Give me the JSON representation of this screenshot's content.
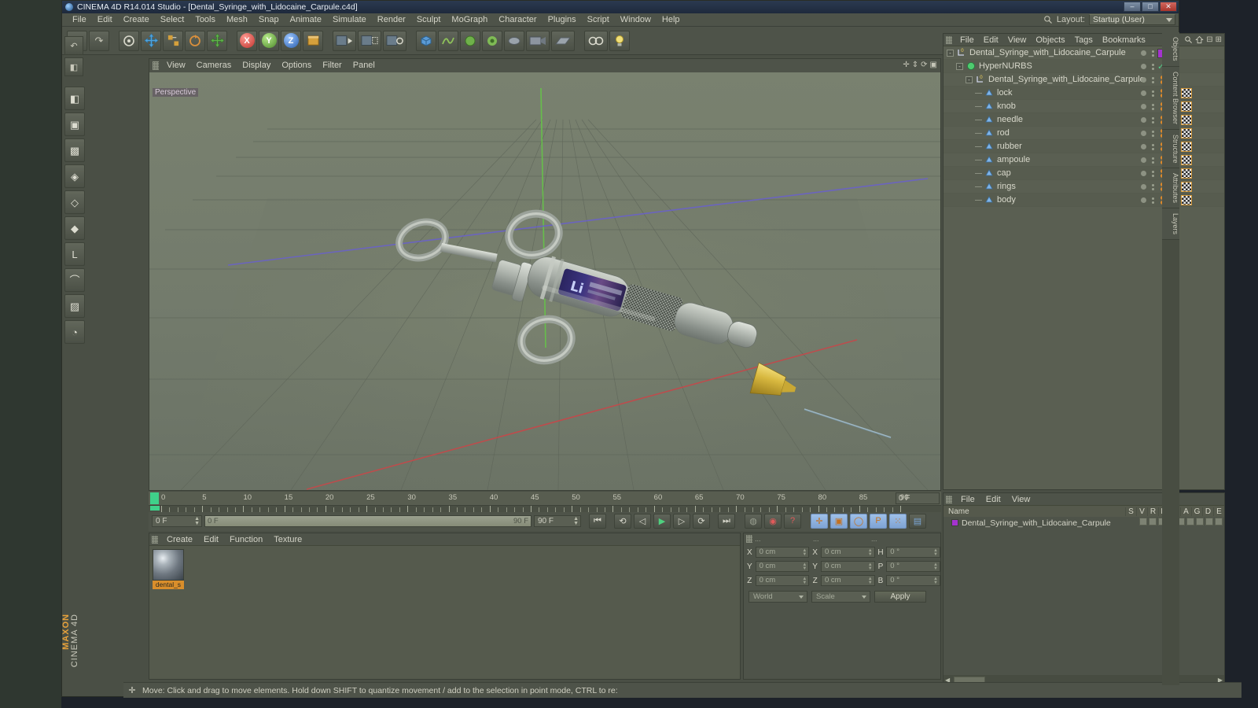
{
  "window": {
    "title": "CINEMA 4D R14.014 Studio - [Dental_Syringe_with_Lidocaine_Carpule.c4d]",
    "min_label": "–",
    "max_label": "□",
    "close_label": "✕"
  },
  "menubar": {
    "items": [
      "File",
      "Edit",
      "Create",
      "Select",
      "Tools",
      "Mesh",
      "Snap",
      "Animate",
      "Simulate",
      "Render",
      "Sculpt",
      "MoGraph",
      "Character",
      "Plugins",
      "Script",
      "Window",
      "Help"
    ],
    "layout_label": "Layout:",
    "layout_value": "Startup (User)"
  },
  "viewport": {
    "menu": [
      "View",
      "Cameras",
      "Display",
      "Options",
      "Filter",
      "Panel"
    ],
    "label": "Perspective",
    "axis_labels": {
      "x": "X",
      "y": "Y",
      "z": "Z"
    }
  },
  "timeline": {
    "ticks": [
      "0",
      "5",
      "10",
      "15",
      "20",
      "25",
      "30",
      "35",
      "40",
      "45",
      "50",
      "55",
      "60",
      "65",
      "70",
      "75",
      "80",
      "85",
      "90"
    ],
    "current_frame_field": "0 F",
    "start_field": "0 F",
    "slider_left": "0 F",
    "slider_right": "90 F",
    "end_field": "90 F",
    "transport": [
      {
        "name": "go-to-start",
        "glyph": "⏮"
      },
      {
        "name": "play-backwards-frame",
        "glyph": "⟲"
      },
      {
        "name": "step-back",
        "glyph": "◁|"
      },
      {
        "name": "play",
        "glyph": "▶"
      },
      {
        "name": "step-forward",
        "glyph": "|▷"
      },
      {
        "name": "loop",
        "glyph": "⟳"
      },
      {
        "name": "go-to-end",
        "glyph": "⏭"
      }
    ],
    "record_buttons": [
      {
        "name": "record-active-objects",
        "glyph": "◉"
      },
      {
        "name": "autokeying",
        "glyph": "?"
      }
    ],
    "key_buttons": [
      {
        "name": "position-key",
        "glyph": "✛"
      },
      {
        "name": "scale-key",
        "glyph": "▣"
      },
      {
        "name": "rotation-key",
        "glyph": "◯"
      },
      {
        "name": "param-key",
        "glyph": "P"
      },
      {
        "name": "point-level-anim",
        "glyph": "⋯"
      },
      {
        "name": "keyframe-select",
        "glyph": "▤"
      }
    ]
  },
  "materials": {
    "menu": [
      "Create",
      "Edit",
      "Function",
      "Texture"
    ],
    "items": [
      {
        "name": "dental_s"
      }
    ]
  },
  "coordinates": {
    "headers": [
      "...",
      "...",
      "..."
    ],
    "rows": [
      {
        "l1": "X",
        "v1": "0 cm",
        "l2": "X",
        "v2": "0 cm",
        "l3": "H",
        "v3": "0 °"
      },
      {
        "l1": "Y",
        "v1": "0 cm",
        "l2": "Y",
        "v2": "0 cm",
        "l3": "P",
        "v3": "0 °"
      },
      {
        "l1": "Z",
        "v1": "0 cm",
        "l2": "Z",
        "v2": "0 cm",
        "l3": "B",
        "v3": "0 °"
      }
    ],
    "system_select": "World",
    "mode_select": "Scale",
    "apply_label": "Apply"
  },
  "object_manager": {
    "menu": [
      "File",
      "Edit",
      "View",
      "Objects",
      "Tags",
      "Bookmarks"
    ],
    "rows": [
      {
        "label": "Dental_Syringe_with_Lidocaine_Carpule",
        "depth": 0,
        "icon": "null-object-icon",
        "expander": "-",
        "swatch": "#a533cf",
        "has_check": false,
        "has_tags": false,
        "has_orange": false
      },
      {
        "label": "HyperNURBS",
        "depth": 1,
        "icon": "hypernurbs-icon",
        "expander": "-",
        "swatch": "",
        "has_check": true,
        "has_tags": false,
        "has_orange": false
      },
      {
        "label": "Dental_Syringe_with_Lidocaine_Carpule",
        "depth": 2,
        "icon": "null-object-icon",
        "expander": "-",
        "swatch": "",
        "has_check": false,
        "has_tags": false,
        "has_orange": true
      },
      {
        "label": "lock",
        "depth": 3,
        "icon": "polygon-object-icon",
        "expander": "",
        "swatch": "",
        "has_check": false,
        "has_tags": true,
        "has_orange": true
      },
      {
        "label": "knob",
        "depth": 3,
        "icon": "polygon-object-icon",
        "expander": "",
        "swatch": "",
        "has_check": false,
        "has_tags": true,
        "has_orange": true
      },
      {
        "label": "needle",
        "depth": 3,
        "icon": "polygon-object-icon",
        "expander": "",
        "swatch": "",
        "has_check": false,
        "has_tags": true,
        "has_orange": true
      },
      {
        "label": "rod",
        "depth": 3,
        "icon": "polygon-object-icon",
        "expander": "",
        "swatch": "",
        "has_check": false,
        "has_tags": true,
        "has_orange": true
      },
      {
        "label": "rubber",
        "depth": 3,
        "icon": "polygon-object-icon",
        "expander": "",
        "swatch": "",
        "has_check": false,
        "has_tags": true,
        "has_orange": true
      },
      {
        "label": "ampoule",
        "depth": 3,
        "icon": "polygon-object-icon",
        "expander": "",
        "swatch": "",
        "has_check": false,
        "has_tags": true,
        "has_orange": true
      },
      {
        "label": "cap",
        "depth": 3,
        "icon": "polygon-object-icon",
        "expander": "",
        "swatch": "",
        "has_check": false,
        "has_tags": true,
        "has_orange": true
      },
      {
        "label": "rings",
        "depth": 3,
        "icon": "polygon-object-icon",
        "expander": "",
        "swatch": "",
        "has_check": false,
        "has_tags": true,
        "has_orange": true
      },
      {
        "label": "body",
        "depth": 3,
        "icon": "polygon-object-icon",
        "expander": "",
        "swatch": "",
        "has_check": false,
        "has_tags": true,
        "has_orange": true
      }
    ]
  },
  "attributes": {
    "menu": [
      "File",
      "Edit",
      "View"
    ],
    "columns": [
      "Name",
      "S",
      "V",
      "R",
      "M",
      "L",
      "A",
      "G",
      "D",
      "E"
    ],
    "rows": [
      {
        "label": "Dental_Syringe_with_Lidocaine_Carpule",
        "swatch": "#a533cf"
      }
    ]
  },
  "right_tabs": [
    "Objects",
    "Content Browser",
    "Structure",
    "Attributes",
    "Layers"
  ],
  "statusbar": {
    "text": "Move: Click and drag to move elements. Hold down SHIFT to quantize movement / add to the selection in point mode, CTRL to re:"
  },
  "brand": {
    "line1": "MAXON",
    "line2": "CINEMA 4D"
  },
  "toolbar": {
    "groups": [
      [
        {
          "name": "undo-button",
          "glyph": "↶"
        },
        {
          "name": "redo-button",
          "glyph": "↷"
        }
      ],
      [
        {
          "name": "live-selection-button",
          "glyph": "◍"
        },
        {
          "name": "move-button",
          "glyph": "✛"
        },
        {
          "name": "scale-button",
          "glyph": "▣"
        },
        {
          "name": "rotate-button",
          "glyph": "⟳"
        },
        {
          "name": "move-alt-button",
          "glyph": "✛"
        }
      ],
      [
        {
          "name": "lock-x-axis-button",
          "glyph": "X"
        },
        {
          "name": "lock-y-axis-button",
          "glyph": "Y"
        },
        {
          "name": "lock-z-axis-button",
          "glyph": "Z"
        },
        {
          "name": "world-coordinate-button",
          "glyph": "▦"
        }
      ],
      [
        {
          "name": "render-view-button",
          "glyph": "▶▦"
        },
        {
          "name": "render-region-button",
          "glyph": "▦▶"
        },
        {
          "name": "render-settings-button",
          "glyph": "▦⚙"
        }
      ],
      [
        {
          "name": "cube-primitive-button",
          "glyph": "◼"
        },
        {
          "name": "spline-button",
          "glyph": "∿"
        },
        {
          "name": "generator-button",
          "glyph": "◆"
        },
        {
          "name": "deformer-button",
          "glyph": "✺"
        },
        {
          "name": "scene-object-button",
          "glyph": "⬬"
        },
        {
          "name": "camera-button",
          "glyph": "▤"
        },
        {
          "name": "floor-button",
          "glyph": "▱"
        }
      ],
      [
        {
          "name": "mograph-button",
          "glyph": "∞"
        },
        {
          "name": "light-button",
          "glyph": "💡"
        }
      ]
    ]
  },
  "left_toolbar": [
    {
      "name": "make-editable-button",
      "glyph": "◧",
      "selected": false
    },
    {
      "name": "model-mode-button",
      "glyph": "▣",
      "selected": false
    },
    {
      "name": "texture-mode-button",
      "glyph": "▩",
      "selected": false
    },
    {
      "name": "points-mode-button",
      "glyph": "◈",
      "selected": false
    },
    {
      "name": "edges-mode-button",
      "glyph": "◇",
      "selected": false
    },
    {
      "name": "polygons-mode-button",
      "glyph": "◆",
      "selected": false
    },
    {
      "name": "axis-modify-button",
      "glyph": "L",
      "selected": false
    },
    {
      "name": "enable-snapping-button",
      "glyph": "⌒",
      "selected": false
    },
    {
      "name": "workplane-button",
      "glyph": "▨",
      "selected": false
    },
    {
      "name": "lock-workplane-button",
      "glyph": "◔",
      "selected": false
    }
  ]
}
